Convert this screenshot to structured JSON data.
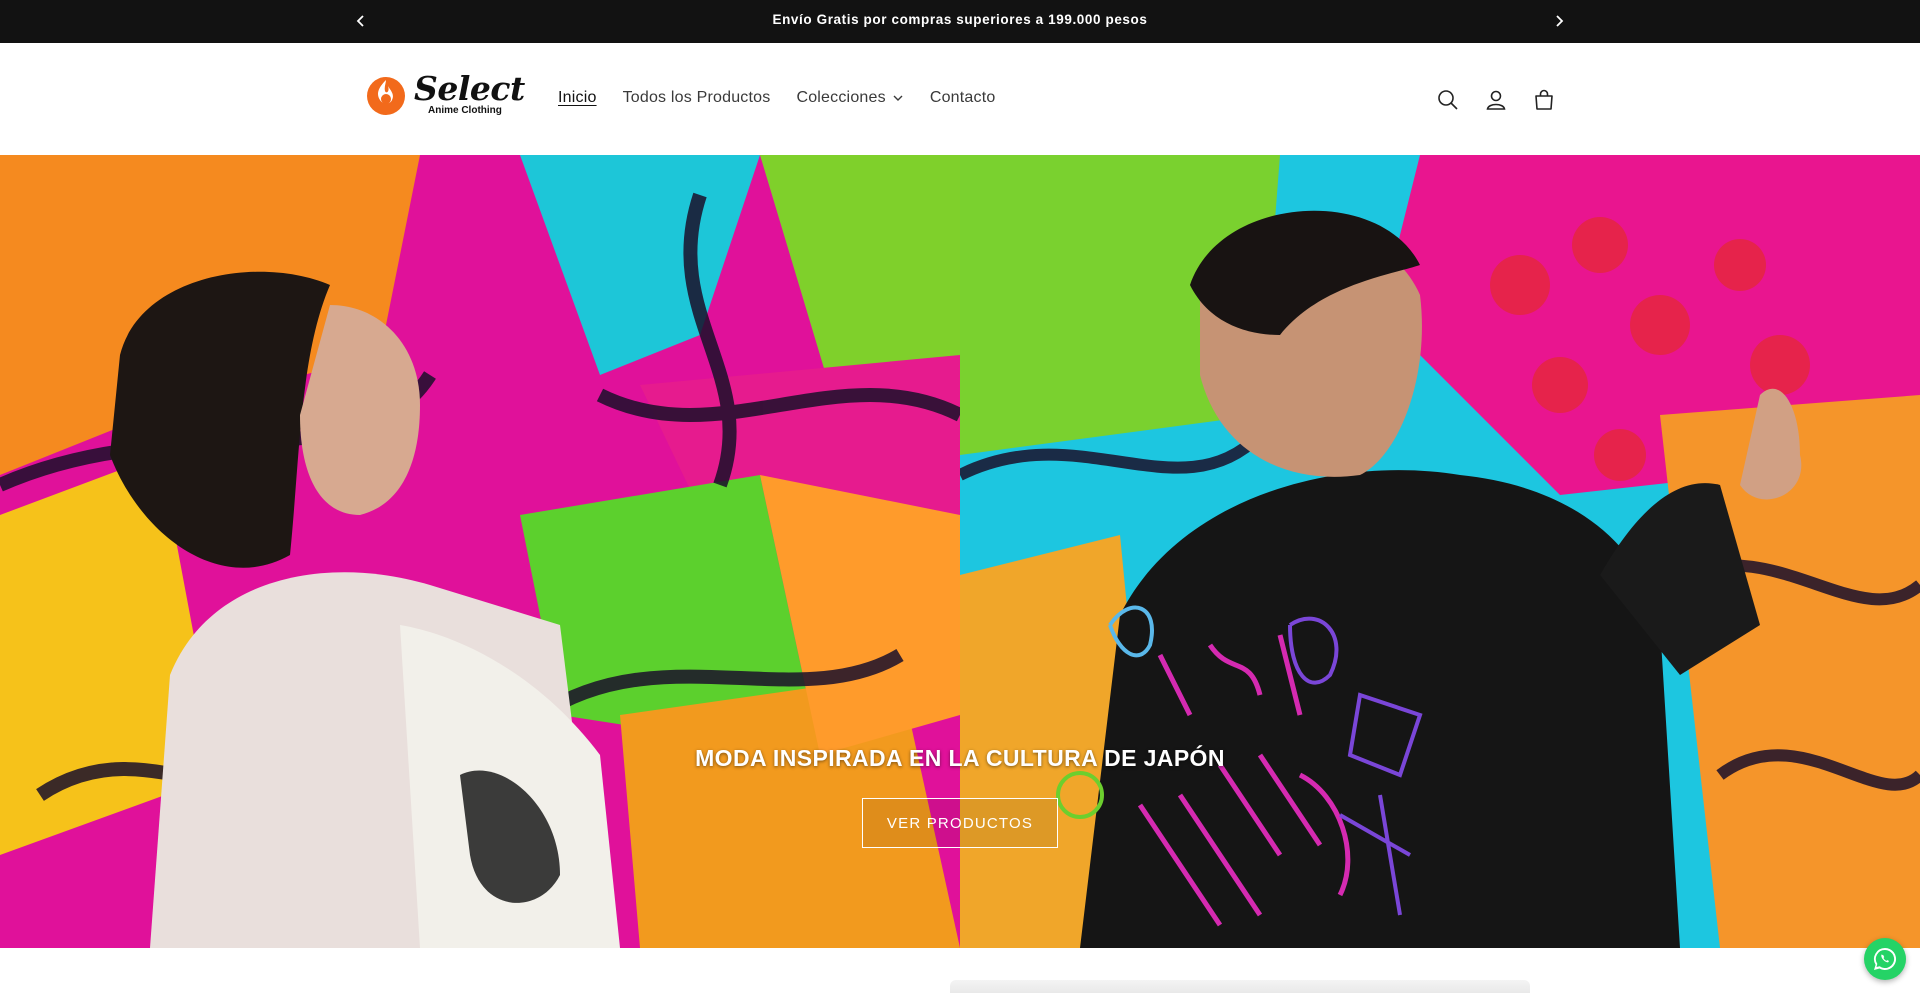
{
  "announcement": {
    "message": "Envío Gratis por compras superiores a 199.000 pesos",
    "prev_icon": "chevron-left-icon",
    "next_icon": "chevron-right-icon"
  },
  "header": {
    "logo": {
      "wordmark": "Select",
      "tagline": "Anime Clothing",
      "brand_color": "#f26a1b"
    },
    "nav": [
      {
        "label": "Inicio",
        "active": true
      },
      {
        "label": "Todos los Productos",
        "active": false
      },
      {
        "label": "Colecciones",
        "active": false,
        "dropdown": true
      },
      {
        "label": "Contacto",
        "active": false
      }
    ],
    "icons": [
      "search-icon",
      "account-icon",
      "cart-icon"
    ]
  },
  "hero": {
    "title": "MODA INSPIRADA EN LA CULTURA DE JAPÓN",
    "button_label": "VER PRODUCTOS",
    "left_image": "woman in light hoodie in front of graffiti mural",
    "right_image": "man in black printed hoodie touching graffiti mural"
  },
  "floating": {
    "whatsapp_icon": "whatsapp-icon",
    "color": "#25d366"
  },
  "colors": {
    "announcement_bg": "#121212",
    "text": "#121212",
    "accent": "#f26a1b"
  }
}
